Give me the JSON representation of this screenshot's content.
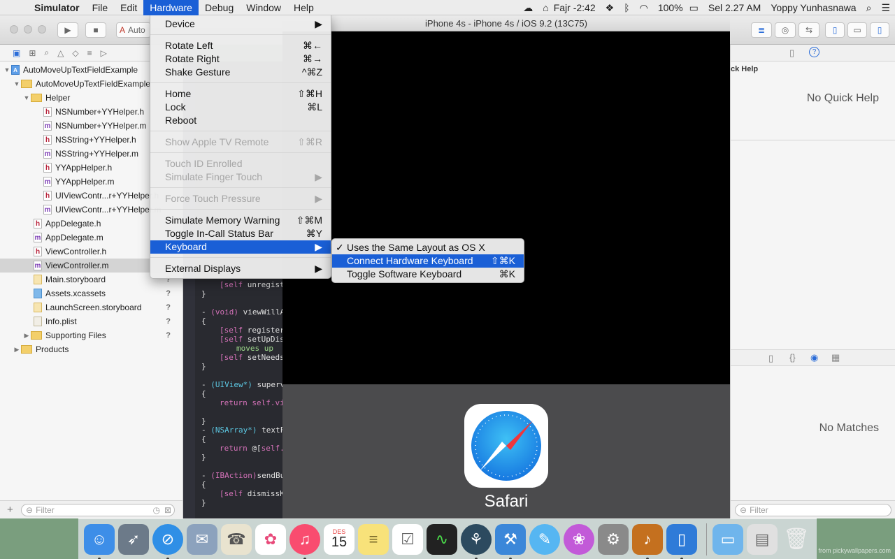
{
  "menubar": {
    "app": "Simulator",
    "items": [
      "File",
      "Edit",
      "Hardware",
      "Debug",
      "Window",
      "Help"
    ],
    "status": {
      "prayer": "Fajr -2:42",
      "battery": "100%",
      "clock": "Sel 2.27 AM",
      "user": "Yoppy Yunhasnawa"
    }
  },
  "xcode": {
    "scheme_label": "Auto",
    "project": "AutoMoveUpTextFieldExample",
    "group": "AutoMoveUpTextFieldExample",
    "helper_folder": "Helper",
    "files": [
      {
        "name": "NSNumber+YYHelper.h",
        "type": "h"
      },
      {
        "name": "NSNumber+YYHelper.m",
        "type": "m"
      },
      {
        "name": "NSString+YYHelper.h",
        "type": "h"
      },
      {
        "name": "NSString+YYHelper.m",
        "type": "m"
      },
      {
        "name": "YYAppHelper.h",
        "type": "h"
      },
      {
        "name": "YYAppHelper.m",
        "type": "m"
      },
      {
        "name": "UIViewContr...r+YYHelper.h",
        "type": "h"
      },
      {
        "name": "UIViewContr...r+YYHelper.m",
        "type": "m"
      }
    ],
    "group_files": [
      {
        "name": "AppDelegate.h",
        "type": "h"
      },
      {
        "name": "AppDelegate.m",
        "type": "m"
      },
      {
        "name": "ViewController.h",
        "type": "h"
      },
      {
        "name": "ViewController.m",
        "type": "m"
      },
      {
        "name": "Main.storyboard",
        "badge": "?"
      },
      {
        "name": "Assets.xcassets",
        "badge": "?"
      },
      {
        "name": "LaunchScreen.storyboard",
        "badge": "?"
      },
      {
        "name": "Info.plist",
        "badge": "?"
      },
      {
        "name": "Supporting Files",
        "badge": "?"
      }
    ],
    "products": "Products",
    "filter_placeholder": "Filter",
    "code": [
      {
        "kw": "[self",
        "rest": " unregist"
      },
      {
        "plain": "}"
      },
      {
        "plain": "- ",
        "kw2": "(void)",
        "rest": " viewWillA"
      },
      {
        "plain": "{"
      },
      {
        "kw": "[self",
        "rest": " register"
      },
      {
        "kw": "[self",
        "rest": " setUpDis"
      },
      {
        "rest": "moves up"
      },
      {
        "kw": "[self",
        "rest": " setNeeds"
      },
      {
        "plain": "}"
      },
      {
        "plain": "- ",
        "ty": "(UIView*)",
        "rest": " superv"
      },
      {
        "plain": "{"
      },
      {
        "kw": "return",
        "kw3": " self.vi"
      },
      {
        "plain": "}"
      },
      {
        "plain": "- ",
        "ty": "(NSArray*)",
        "rest": " textF"
      },
      {
        "plain": "{"
      },
      {
        "kw": "return",
        "rest": " @[",
        "kw3": "self."
      },
      {
        "plain": "}"
      },
      {
        "plain": "- ",
        "kw2": "(IBAction)",
        "rest": "sendBu"
      },
      {
        "plain": "{"
      },
      {
        "kw": "[self",
        "rest": " dismissK"
      },
      {
        "plain": "}"
      }
    ],
    "quick_help_head": "ck Help",
    "no_quick_help": "No Quick Help",
    "no_matches": "No Matches"
  },
  "simulator": {
    "title": "iPhone 4s - iPhone 4s / iOS 9.2 (13C75)",
    "app_label": "Safari",
    "colors": {
      "dock_bg": "#4b4b4d",
      "screen": "#000000"
    }
  },
  "hardware_menu": {
    "items": [
      {
        "label": "Device",
        "shortcut": "",
        "submenu": true
      },
      {
        "label": "Rotate Left",
        "shortcut": "⌘←"
      },
      {
        "label": "Rotate Right",
        "shortcut": "⌘→"
      },
      {
        "label": "Shake Gesture",
        "shortcut": "^⌘Z"
      },
      {
        "label": "Home",
        "shortcut": "⇧⌘H"
      },
      {
        "label": "Lock",
        "shortcut": "⌘L"
      },
      {
        "label": "Reboot",
        "shortcut": ""
      },
      {
        "label": "Show Apple TV Remote",
        "shortcut": "⇧⌘R",
        "disabled": true
      },
      {
        "label": "Touch ID Enrolled",
        "shortcut": "",
        "disabled": true
      },
      {
        "label": "Simulate Finger Touch",
        "shortcut": "",
        "disabled": true,
        "submenu": true
      },
      {
        "label": "Force Touch Pressure",
        "shortcut": "",
        "disabled": true,
        "submenu": true
      },
      {
        "label": "Simulate Memory Warning",
        "shortcut": "⇧⌘M"
      },
      {
        "label": "Toggle In-Call Status Bar",
        "shortcut": "⌘Y"
      },
      {
        "label": "Keyboard",
        "shortcut": "",
        "submenu": true,
        "highlighted": true
      },
      {
        "label": "External Displays",
        "shortcut": "",
        "submenu": true
      }
    ],
    "submenu_arrow": "▶"
  },
  "keyboard_menu": {
    "items": [
      {
        "label": "Uses the Same Layout as OS X",
        "shortcut": "",
        "checked": true
      },
      {
        "label": "Connect Hardware Keyboard",
        "shortcut": "⇧⌘K",
        "highlighted": true
      },
      {
        "label": "Toggle Software Keyboard",
        "shortcut": "⌘K"
      }
    ],
    "check": "✓"
  },
  "dock": {
    "calendar_month": "DES",
    "calendar_day": "15",
    "credit": "from pickywallpapers.com"
  },
  "colors": {
    "accent": "#1a5fd6",
    "disabled": "#a6a6a6"
  }
}
